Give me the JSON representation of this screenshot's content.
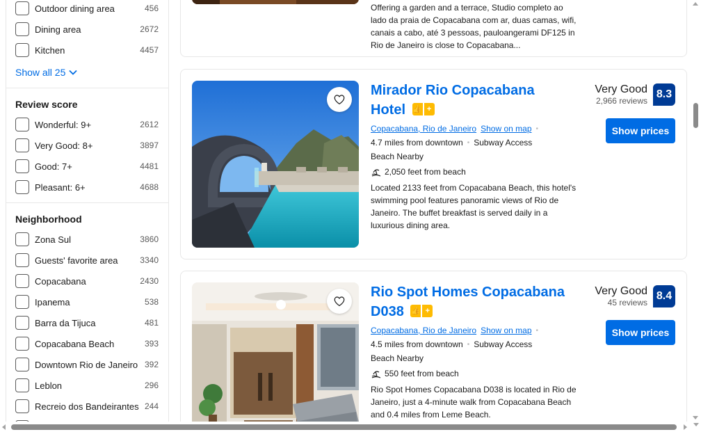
{
  "sidebar": {
    "facilities": [
      {
        "label": "Outdoor dining area",
        "count": "456"
      },
      {
        "label": "Dining area",
        "count": "2672"
      },
      {
        "label": "Kitchen",
        "count": "4457"
      }
    ],
    "show_all_label": "Show all 25",
    "review_score": {
      "title": "Review score",
      "items": [
        {
          "label": "Wonderful: 9+",
          "count": "2612"
        },
        {
          "label": "Very Good: 8+",
          "count": "3897"
        },
        {
          "label": "Good: 7+",
          "count": "4481"
        },
        {
          "label": "Pleasant: 6+",
          "count": "4688"
        }
      ]
    },
    "neighborhood": {
      "title": "Neighborhood",
      "items": [
        {
          "label": "Zona Sul",
          "count": "3860"
        },
        {
          "label": "Guests' favorite area",
          "count": "3340"
        },
        {
          "label": "Copacabana",
          "count": "2430"
        },
        {
          "label": "Ipanema",
          "count": "538"
        },
        {
          "label": "Barra da Tijuca",
          "count": "481"
        },
        {
          "label": "Copacabana Beach",
          "count": "393"
        },
        {
          "label": "Downtown Rio de Janeiro",
          "count": "392"
        },
        {
          "label": "Leblon",
          "count": "296"
        },
        {
          "label": "Recreio dos Bandeirantes",
          "count": "244"
        }
      ]
    }
  },
  "listing_top": {
    "description": "Offering a garden and a terrace, Studio completo ao lado da praia de Copacabana com ar, duas camas, wifi, canais a cabo, até 3 pessoas, pauloangerami DF125 in Rio de Janeiro is close to Copacabana..."
  },
  "listings": [
    {
      "title": "Mirador Rio Copacabana Hotel",
      "location": "Copacabana, Rio de Janeiro",
      "map_link": "Show on map",
      "distance": "4.7 miles from downtown",
      "transit": "Subway Access",
      "tag": "Beach Nearby",
      "beach_distance": "2,050 feet from beach",
      "description": "Located 2133 feet from Copacabana Beach, this hotel's swimming pool features panoramic views of Rio de Janeiro. The buffet breakfast is served daily in a luxurious dining area.",
      "rating_word": "Very Good",
      "reviews": "2,966 reviews",
      "score": "8.3",
      "cta": "Show prices"
    },
    {
      "title": "Rio Spot Homes Copacabana D038",
      "location": "Copacabana, Rio de Janeiro",
      "map_link": "Show on map",
      "distance": "4.5 miles from downtown",
      "transit": "Subway Access",
      "tag": "Beach Nearby",
      "beach_distance": "550 feet from beach",
      "description": "Rio Spot Homes Copacabana D038 is located in Rio de Janeiro, just a 4-minute walk from Copacabana Beach and 0.4 miles from Leme Beach.",
      "rating_word": "Very Good",
      "reviews": "45 reviews",
      "score": "8.4",
      "cta": "Show prices"
    }
  ],
  "colors": {
    "link": "#006ce4",
    "score_bg": "#003b95",
    "genius_yellow": "#febb02"
  },
  "icons": {
    "heart": "heart-icon",
    "beach": "beach-icon",
    "chevron": "chevron-down-icon",
    "genius": "thumbs-up-icon"
  }
}
